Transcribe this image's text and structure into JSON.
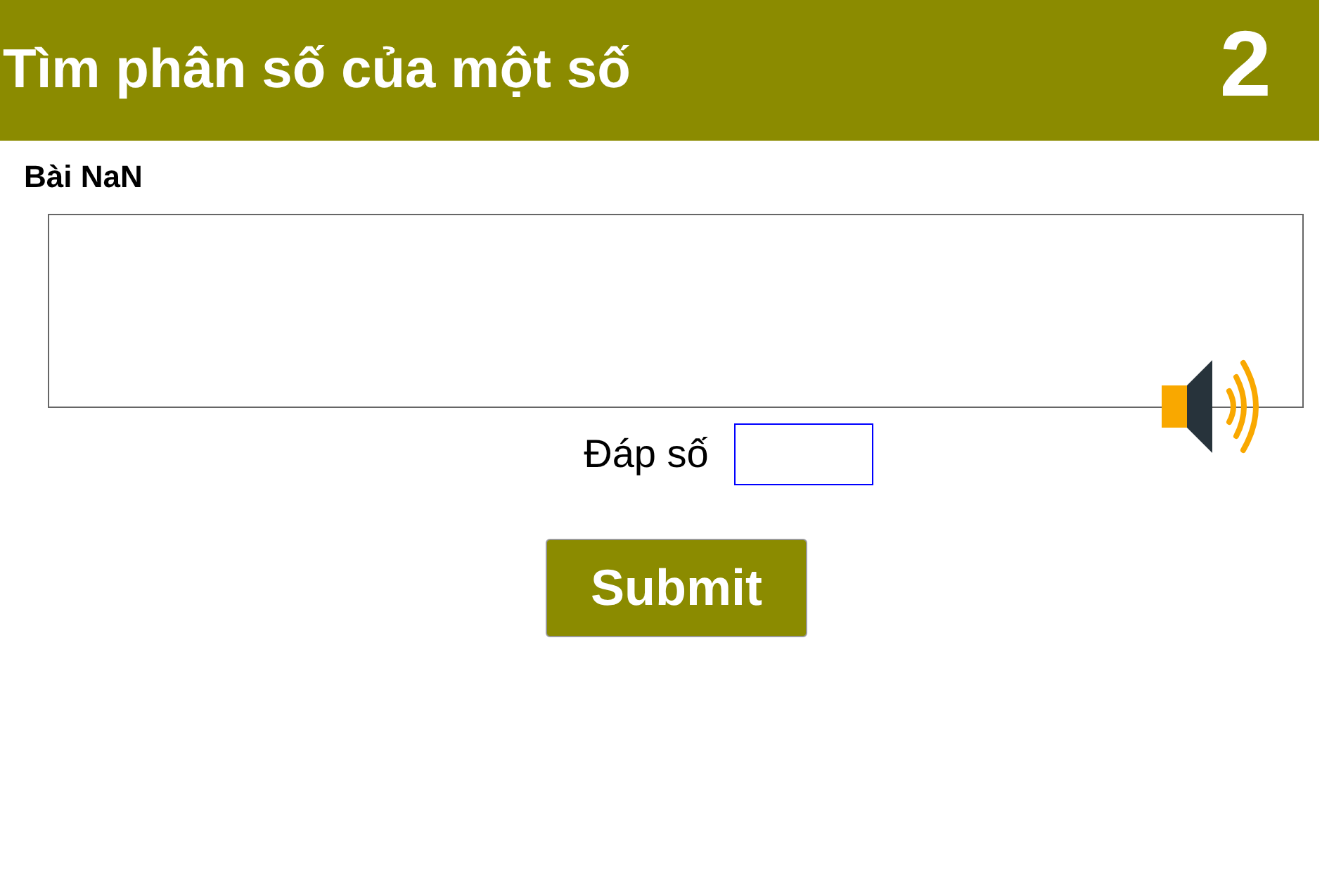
{
  "header": {
    "title": "Tìm phân số của một số",
    "number": "2"
  },
  "problem": {
    "label": "Bài NaN"
  },
  "answer": {
    "label": "Đáp số"
  },
  "submit": {
    "label": "Submit"
  }
}
